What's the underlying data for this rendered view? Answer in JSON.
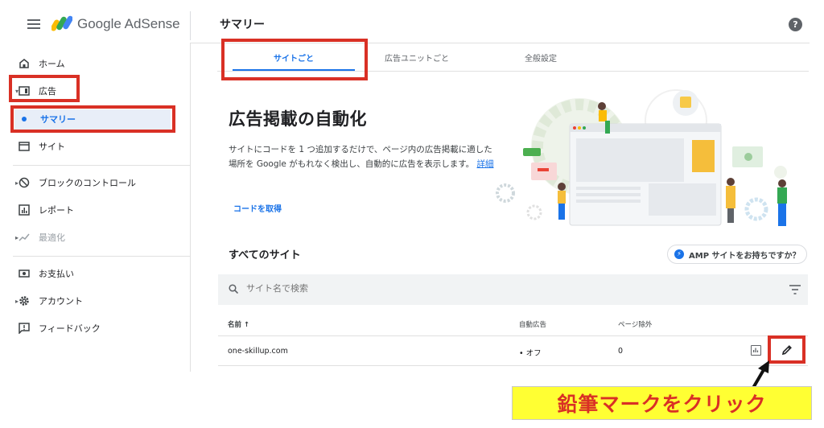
{
  "header": {
    "brand": "Google AdSense",
    "page_title": "サマリー",
    "help_glyph": "?"
  },
  "sidebar": {
    "items": [
      {
        "label": "ホーム",
        "icon": "home-icon"
      },
      {
        "label": "広告",
        "icon": "ads-icon"
      },
      {
        "label": "サマリー",
        "icon": "bullet-icon"
      },
      {
        "label": "サイト",
        "icon": "sites-icon"
      },
      {
        "label": "ブロックのコントロール",
        "icon": "block-icon"
      },
      {
        "label": "レポート",
        "icon": "report-icon"
      },
      {
        "label": "最適化",
        "icon": "optimize-icon"
      },
      {
        "label": "お支払い",
        "icon": "payment-icon"
      },
      {
        "label": "アカウント",
        "icon": "gear-icon"
      },
      {
        "label": "フィードバック",
        "icon": "feedback-icon"
      }
    ]
  },
  "tabs": [
    {
      "label": "サイトごと",
      "active": true
    },
    {
      "label": "広告ユニットごと",
      "active": false
    },
    {
      "label": "全般設定",
      "active": false
    }
  ],
  "hero": {
    "title": "広告掲載の自動化",
    "text": "サイトにコードを 1 つ追加するだけで、ページ内の広告掲載に適した場所を Google がもれなく検出し、自動的に広告を表示します。",
    "link": "詳細",
    "get_code": "コードを取得"
  },
  "sites": {
    "title": "すべてのサイト",
    "amp_button": "AMP サイトをお持ちですか？",
    "search_placeholder": "サイト名で検索",
    "columns": {
      "name": "名前 ↑",
      "auto_ads": "自動広告",
      "page_exclusions": "ページ除外"
    },
    "rows": [
      {
        "name": "one-skillup.com",
        "auto_ads": "• オフ",
        "page_exclusions": "0"
      }
    ]
  },
  "annotation": {
    "callout": "鉛筆マークをクリック"
  },
  "colors": {
    "accent": "#1a73e8",
    "highlight_box": "#d93025",
    "callout_bg": "#ffff33"
  }
}
